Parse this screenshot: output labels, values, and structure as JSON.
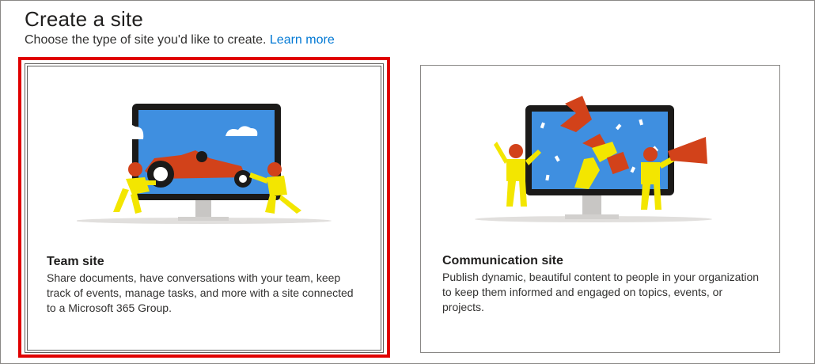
{
  "header": {
    "title": "Create a site",
    "subtitle": "Choose the type of site you'd like to create.",
    "learn_more": "Learn more"
  },
  "cards": [
    {
      "title": "Team site",
      "description": "Share documents, have conversations with your team, keep track of events, manage tasks, and more with a site connected to a Microsoft 365 Group.",
      "illustration": "team-site-illustration",
      "selected": true
    },
    {
      "title": "Communication site",
      "description": "Publish dynamic, beautiful content to people in your organization to keep them informed and engaged on topics, events, or projects.",
      "illustration": "communication-site-illustration",
      "selected": false
    }
  ],
  "colors": {
    "accent_link": "#0078d4",
    "selection_outline": "#e00000",
    "monitor_screen": "#3f8fe0",
    "figure_yellow": "#f3e600",
    "figure_red": "#d2421a"
  }
}
